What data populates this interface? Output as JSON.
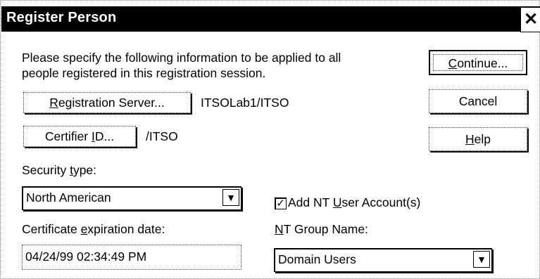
{
  "window": {
    "title": "Register Person",
    "close_glyph": "✕"
  },
  "intro": {
    "line1": "Please specify the following information to be applied to all",
    "line2": "people registered in this registration session."
  },
  "registration_server": {
    "button_prefix": "",
    "button_mnemonic": "R",
    "button_rest": "egistration Server...",
    "value": "ITSOLab1/ITSO"
  },
  "certifier": {
    "button_prefix": "Certifier ",
    "button_mnemonic": "I",
    "button_rest": "D...",
    "value": "/ITSO"
  },
  "security_type": {
    "label_prefix": "Security ",
    "label_mnemonic": "t",
    "label_rest": "ype:",
    "selected": "North American"
  },
  "expiration": {
    "label_prefix": "Certificate ",
    "label_mnemonic": "e",
    "label_rest": "xpiration date:",
    "value": "04/24/99 02:34:49 PM"
  },
  "nt_account": {
    "checked": true,
    "label_prefix": "Add NT ",
    "label_mnemonic": "U",
    "label_rest": "ser Account(s)"
  },
  "nt_group": {
    "label_prefix": "",
    "label_mnemonic": "N",
    "label_rest": "T Group Name:",
    "selected": "Domain Users"
  },
  "buttons": {
    "continue": {
      "mnemonic": "C",
      "rest": "ontinue..."
    },
    "cancel": {
      "label": "Cancel"
    },
    "help": {
      "mnemonic": "H",
      "rest": "elp"
    }
  },
  "icons": {
    "dropdown": "chevron-down-icon",
    "check": "check-icon",
    "close": "close-icon"
  }
}
